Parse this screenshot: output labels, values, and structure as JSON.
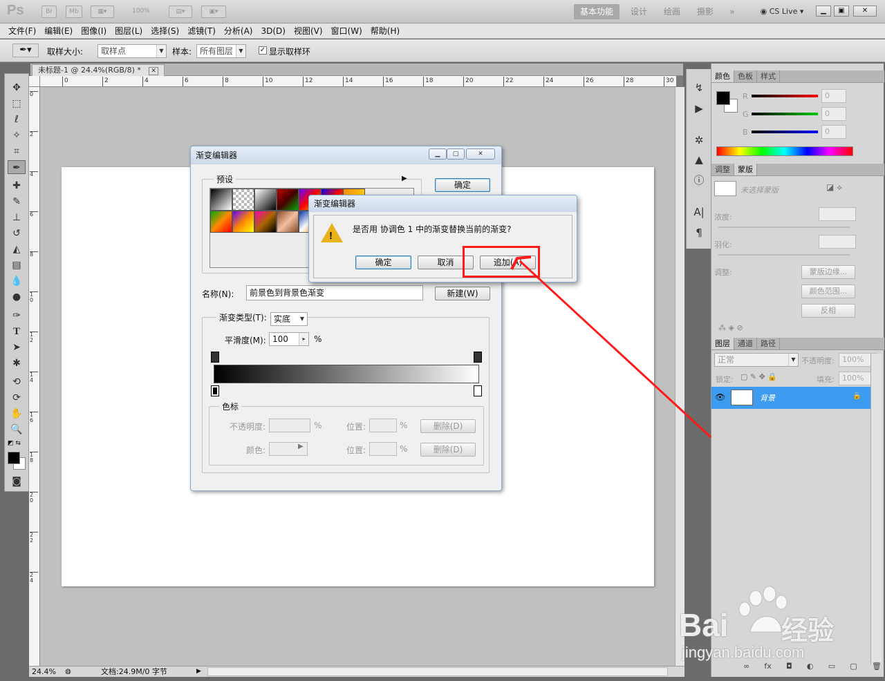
{
  "app": {
    "logo": "Ps",
    "top_buttons": [
      "Br",
      "Mb",
      "100%"
    ],
    "workspaces": [
      "基本功能",
      "设计",
      "绘画",
      "摄影",
      "»"
    ],
    "active_workspace": "基本功能",
    "cs_live": "CS Live ▾",
    "window_controls": [
      "▁",
      "▣",
      "✕"
    ]
  },
  "menu": [
    "文件(F)",
    "编辑(E)",
    "图像(I)",
    "图层(L)",
    "选择(S)",
    "滤镜(T)",
    "分析(A)",
    "3D(D)",
    "视图(V)",
    "窗口(W)",
    "帮助(H)"
  ],
  "options": {
    "sample_size_label": "取样大小:",
    "sample_size_value": "取样点",
    "sample_label": "样本:",
    "sample_value": "所有图层",
    "show_ring_label": "显示取样环"
  },
  "document": {
    "tab_title": "未标题-1 @ 24.4%(RGB/8) *",
    "zoom": "24.4%",
    "doc_info": "文档:24.9M/0 字节",
    "h_ruler": [
      "0",
      "2",
      "4",
      "6",
      "8",
      "10",
      "12",
      "14",
      "16",
      "18",
      "20",
      "22",
      "24",
      "26",
      "28",
      "30"
    ],
    "v_ruler": [
      "0",
      "2",
      "4",
      "6",
      "8",
      "1\n0",
      "1\n2",
      "1\n4",
      "1\n6",
      "1\n8",
      "2\n0",
      "2\n2",
      "2\n4"
    ]
  },
  "gradient_editor": {
    "title": "渐变编辑器",
    "presets_label": "预设",
    "ok": "确定",
    "cancel": "取消",
    "name_label": "名称(N):",
    "name_value": "前景色到背景色渐变",
    "new_button": "新建(W)",
    "type_label": "渐变类型(T):",
    "type_value": "实底",
    "smooth_label": "平滑度(M):",
    "smooth_value": "100",
    "percent": "%",
    "stops_label": "色标",
    "opacity_label": "不透明度:",
    "location_label": "位置:",
    "color_label": "颜色:",
    "delete_label": "删除(D)"
  },
  "confirm_dialog": {
    "title": "渐变编辑器",
    "message": "是否用 协调色 1 中的渐变替换当前的渐变?",
    "ok": "确定",
    "cancel": "取消",
    "append": "追加(A)"
  },
  "panels": {
    "color_tabs": [
      "颜色",
      "色板",
      "样式"
    ],
    "rgb_labels": [
      "R",
      "G",
      "B"
    ],
    "rgb_values": [
      "0",
      "0",
      "0"
    ],
    "adjust_tabs": [
      "调整",
      "蒙版"
    ],
    "mask_label": "未选择蒙版",
    "density_label": "浓度:",
    "feather_label": "羽化:",
    "adjust_label": "调整:",
    "mask_edge": "蒙版边缘...",
    "color_range": "颜色范围...",
    "invert": "反相",
    "layers_tabs": [
      "图层",
      "通道",
      "路径"
    ],
    "blend_mode": "正常",
    "opacity_label": "不透明度:",
    "opacity_value": "100%",
    "lock_label": "锁定:",
    "fill_label": "填充:",
    "fill_value": "100%",
    "layer_name": "背景",
    "footer_icons": [
      "∞",
      "fx",
      "◘",
      "◐",
      "▭",
      "▢",
      "🗑"
    ]
  },
  "watermark": {
    "brand": "Bai",
    "brand2": "经验",
    "url": "jingyan.baidu.com"
  },
  "colors": {
    "highlight_box": "#ff1a1a",
    "layer_selected": "#3d9cf0"
  }
}
